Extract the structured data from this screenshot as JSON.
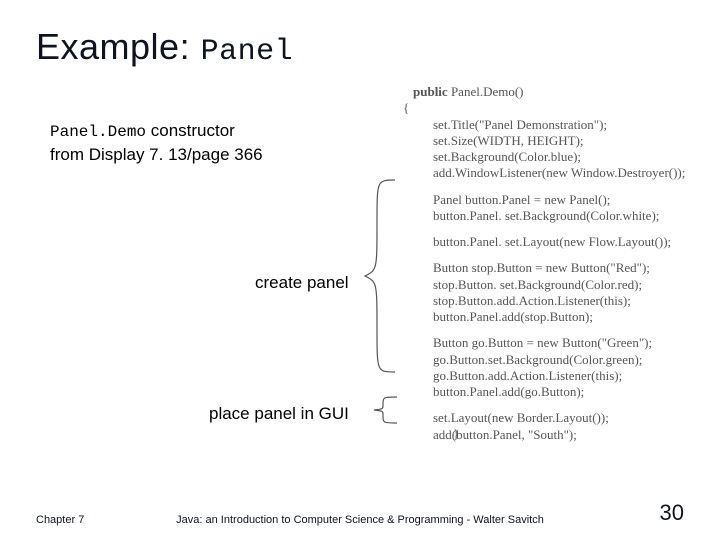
{
  "title": {
    "prefix": "Example: ",
    "mono": "Panel"
  },
  "caption": {
    "mono": "Panel.Demo",
    "rest1": " constructor",
    "line2": "from Display 7. 13/page 366"
  },
  "labels": {
    "create_panel": "create panel",
    "place_panel": "place panel in GUI"
  },
  "code": {
    "l1a": "public",
    "l1b": " Panel.Demo()",
    "l2": "{",
    "l3": "set.Title(\"Panel Demonstration\");",
    "l4": "set.Size(WIDTH, HEIGHT);",
    "l5": "set.Background(Color.blue);",
    "l6": "add.WindowListener(new Window.Destroyer());",
    "l7": "Panel button.Panel = new Panel();",
    "l8": "button.Panel. set.Background(Color.white);",
    "l9": "button.Panel. set.Layout(new Flow.Layout());",
    "l10": "Button stop.Button = new Button(\"Red\");",
    "l11": "stop.Button. set.Background(Color.red);",
    "l12": "stop.Button.add.Action.Listener(this);",
    "l13": "button.Panel.add(stop.Button);",
    "l14": "Button go.Button = new Button(\"Green\");",
    "l15": "go.Button.set.Background(Color.green);",
    "l16": "go.Button.add.Action.Listener(this);",
    "l17": "button.Panel.add(go.Button);",
    "l18": "set.Layout(new Border.Layout());",
    "l19": "add(button.Panel, \"South\");",
    "l20": "}"
  },
  "footer": {
    "left": "Chapter 7",
    "center": "Java: an Introduction to Computer Science & Programming - Walter Savitch",
    "page": "30"
  }
}
